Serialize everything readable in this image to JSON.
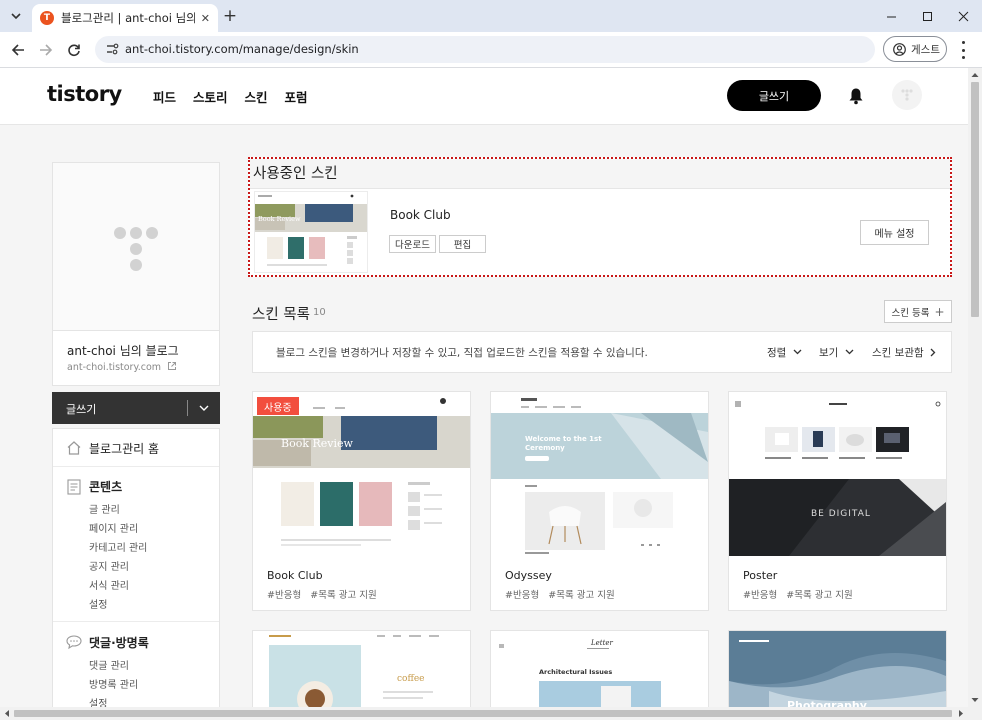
{
  "browser": {
    "tab_title": "블로그관리 | ant-choi 님의 블로그",
    "favicon_letter": "T",
    "url": "ant-choi.tistory.com/manage/design/skin",
    "guest_label": "게스트"
  },
  "header": {
    "logo": "tistory",
    "nav": [
      "피드",
      "스토리",
      "스킨",
      "포럼"
    ],
    "write_label": "글쓰기"
  },
  "sidebar": {
    "blog_name": "ant-choi 님의 블로그",
    "blog_url": "ant-choi.tistory.com",
    "write_label": "글쓰기",
    "home_label": "블로그관리 홈",
    "contents_title": "콘텐츠",
    "contents_items": [
      "글 관리",
      "페이지 관리",
      "카테고리 관리",
      "공지 관리",
      "서식 관리",
      "설정"
    ],
    "comments_title": "댓글·방명록",
    "comments_items": [
      "댓글 관리",
      "방명록 관리",
      "설정"
    ]
  },
  "used_skin": {
    "section_title": "사용중인 스킨",
    "name": "Book Club",
    "download_label": "다운로드",
    "edit_label": "편집",
    "menu_settings_label": "메뉴 설정",
    "thumb_text": "Book Review"
  },
  "skin_list": {
    "title": "스킨 목록",
    "count": "10",
    "register_label": "스킨 등록",
    "info_text": "블로그 스킨을 변경하거나 저장할 수 있고, 직접 업로드한 스킨을 적용할 수 있습니다.",
    "sort_label": "정렬",
    "view_label": "보기",
    "storage_label": "스킨 보관함",
    "using_badge": "사용중",
    "skins": [
      {
        "name": "Book Club",
        "tags": "#반응형   #목록 광고 지원",
        "thumb_text": "Book Review"
      },
      {
        "name": "Odyssey",
        "tags": "#반응형   #목록 광고 지원",
        "thumb_text": "Welcome to the 1st Ceremony"
      },
      {
        "name": "Poster",
        "tags": "#반응형   #목록 광고 지원",
        "thumb_text": "BE DIGITAL"
      }
    ],
    "partial_skins": [
      {
        "thumb_text": "coffee",
        "sub_text": "Architectural Issues",
        "brand": "Letter"
      },
      {
        "thumb_text": "Photography"
      }
    ]
  },
  "colors": {
    "accent_red": "#f24e3e",
    "dark": "#333333",
    "black": "#000000"
  }
}
